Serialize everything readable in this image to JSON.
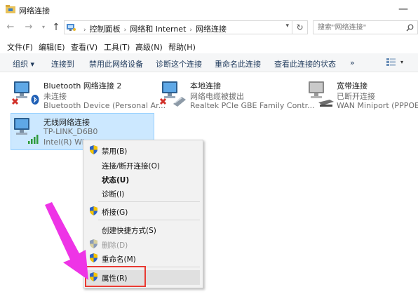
{
  "window": {
    "title": "网络连接",
    "minimize_glyph": "—"
  },
  "address": {
    "crumbs": [
      "控制面板",
      "网络和 Internet",
      "网络连接"
    ],
    "search_placeholder": "搜索\"网络连接\""
  },
  "menubar": [
    "文件(F)",
    "编辑(E)",
    "查看(V)",
    "工具(T)",
    "高级(N)",
    "帮助(H)"
  ],
  "toolbar": {
    "items": [
      "组织 ▾",
      "连接到",
      "禁用此网络设备",
      "诊断这个连接",
      "重命名此连接",
      "查看此连接的状态",
      "»"
    ],
    "view_dropdown": "▾"
  },
  "connections": [
    {
      "name": "Bluetooth 网络连接 2",
      "status": "未连接",
      "device": "Bluetooth Device (Personal Ar..."
    },
    {
      "name": "本地连接",
      "status": "网络电缆被拔出",
      "device": "Realtek PCIe GBE Family Contr..."
    },
    {
      "name": "宽带连接",
      "status": "已断开连接",
      "device": "WAN Miniport (PPPOE)"
    },
    {
      "name": "无线网络连接",
      "status": "TP-LINK_D6B0",
      "device": "Intel(R) Wire"
    }
  ],
  "context_menu": [
    {
      "label": "禁用(B)",
      "shield": true,
      "bold": false,
      "disabled": false
    },
    {
      "label": "连接/断开连接(O)",
      "shield": false,
      "bold": false,
      "disabled": false
    },
    {
      "label": "状态(U)",
      "shield": false,
      "bold": true,
      "disabled": false
    },
    {
      "label": "诊断(I)",
      "shield": false,
      "bold": false,
      "disabled": false
    },
    {
      "label": "桥接(G)",
      "shield": true,
      "bold": false,
      "disabled": false
    },
    {
      "label": "创建快捷方式(S)",
      "shield": false,
      "bold": false,
      "disabled": false
    },
    {
      "label": "删除(D)",
      "shield": true,
      "bold": false,
      "disabled": true
    },
    {
      "label": "重命名(M)",
      "shield": true,
      "bold": false,
      "disabled": false
    },
    {
      "label": "属性(R)",
      "shield": true,
      "bold": false,
      "disabled": false
    }
  ],
  "colors": {
    "selection": "#cce8ff",
    "highlight_box": "#e83a32",
    "arrow": "#ee34e6",
    "disconnected_x": "#d1312a"
  }
}
